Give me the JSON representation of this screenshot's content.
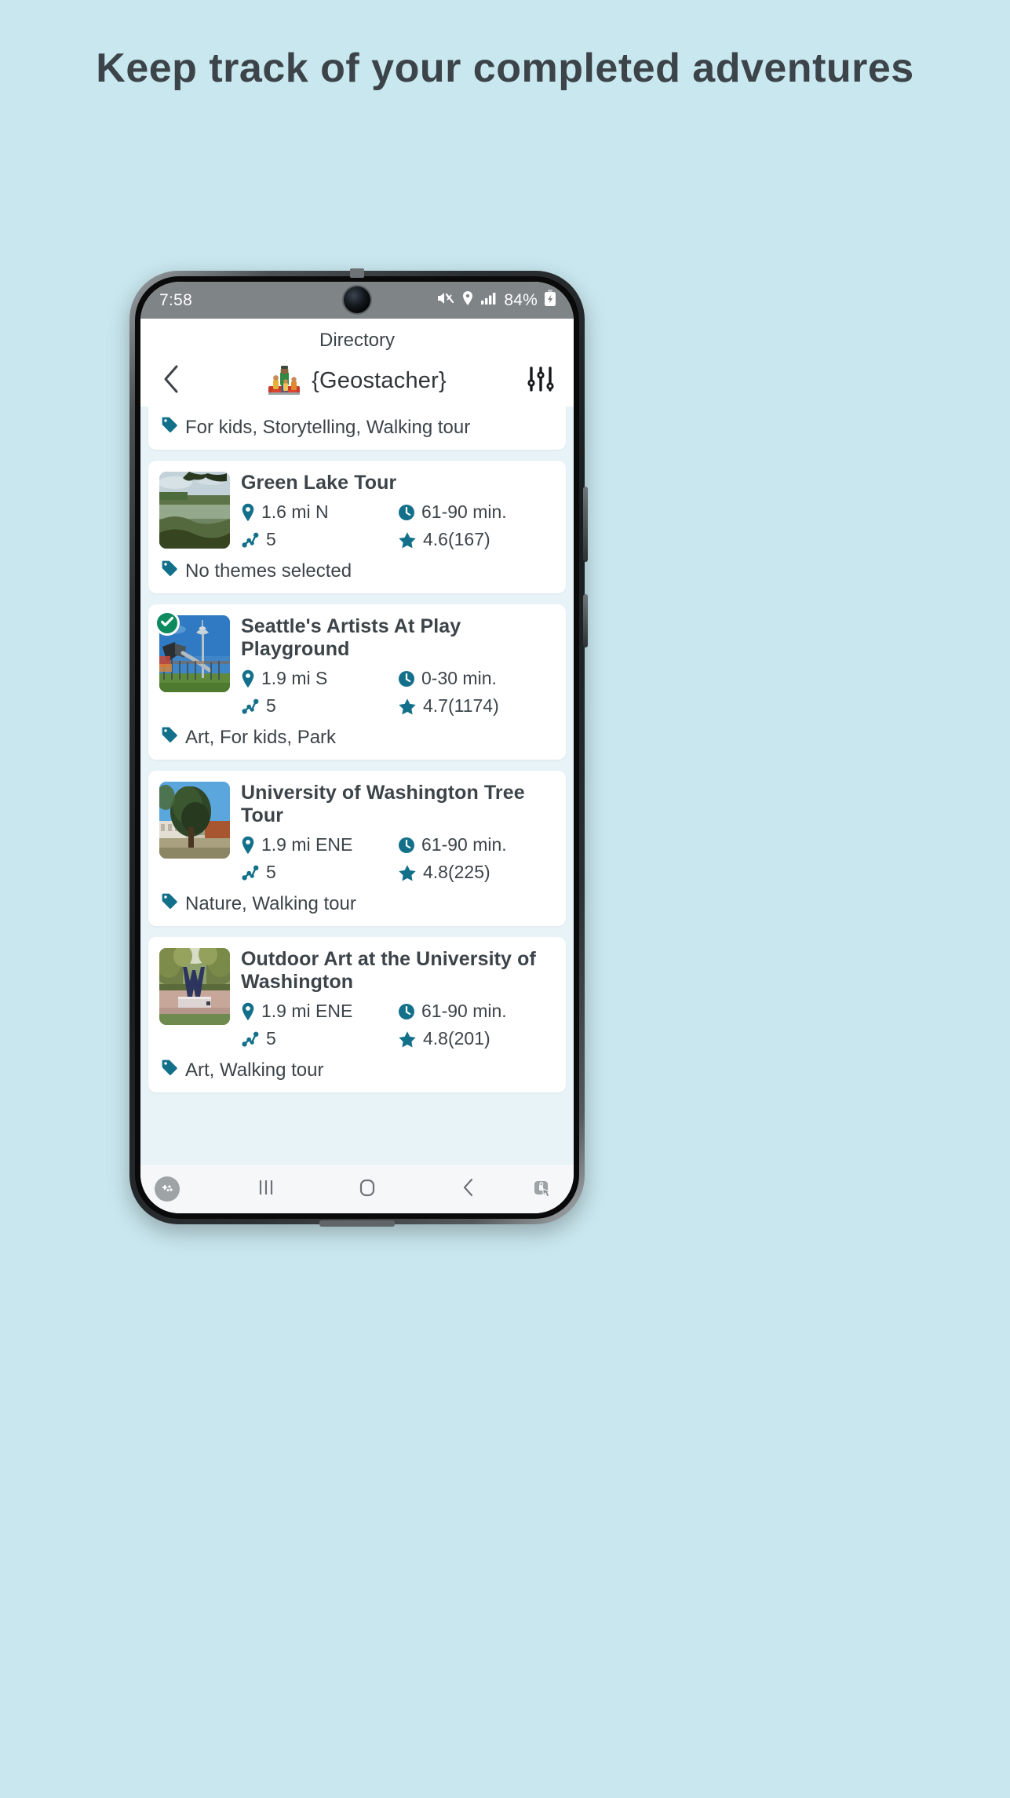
{
  "headline": "Keep track of your completed adventures",
  "colors": {
    "background": "#c9e7ef",
    "accent_teal": "#13708a",
    "done_green": "#0e8a5f",
    "text_dark": "#3c4449",
    "list_background": "#e7f3f7"
  },
  "status_bar": {
    "time": "7:58",
    "battery_percent": "84%",
    "icons": [
      "mute-icon",
      "location-icon",
      "signal-icon",
      "battery-charging-icon"
    ]
  },
  "app_bar": {
    "screen_label": "Directory",
    "title": "{Geostacher}",
    "back_icon": "chevron-left-icon",
    "filter_icon": "sliders-icon",
    "logo_icon": "geostacher-logo-icon"
  },
  "list": {
    "partial_card": {
      "themes": "For kids, Storytelling, Walking tour"
    },
    "cards": [
      {
        "title": "Green Lake Tour",
        "distance": "1.6 mi N",
        "duration": "61-90 min.",
        "stops": "5",
        "rating": "4.6(167)",
        "themes": "No themes selected",
        "completed": false,
        "thumb": "green-lake-photo"
      },
      {
        "title": "Seattle's Artists At Play Playground",
        "distance": "1.9 mi S",
        "duration": "0-30 min.",
        "stops": "5",
        "rating": "4.7(1174)",
        "themes": "Art, For kids, Park",
        "completed": true,
        "thumb": "space-needle-playground-photo"
      },
      {
        "title": "University of Washington Tree Tour",
        "distance": "1.9 mi ENE",
        "duration": "61-90 min.",
        "stops": "5",
        "rating": "4.8(225)",
        "themes": "Nature, Walking tour",
        "completed": false,
        "thumb": "campus-tree-photo"
      },
      {
        "title": "Outdoor Art at the University of Washington",
        "distance": "1.9 mi ENE",
        "duration": "61-90 min.",
        "stops": "5",
        "rating": "4.8(201)",
        "themes": "Art, Walking tour",
        "completed": false,
        "thumb": "uw-w-sculpture-photo"
      }
    ]
  },
  "nav_bar": {
    "lock_icon": "game-booster-icon",
    "recents_icon": "recents-icon",
    "home_icon": "home-icon",
    "back_icon": "back-icon",
    "touch_lock_icon": "touch-lock-icon"
  }
}
